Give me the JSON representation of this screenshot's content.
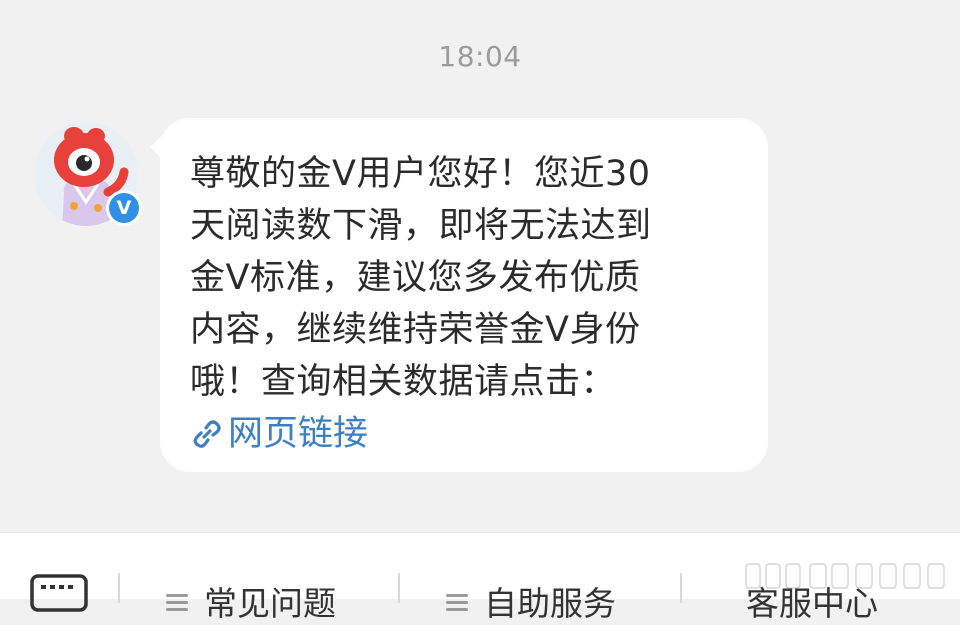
{
  "chat": {
    "timestamp": "18:04",
    "message": {
      "lines": [
        "尊敬的金V用户您好！您近30",
        "天阅读数下滑，即将无法达到",
        "金V标准，建议您多发布优质",
        "内容，继续维持荣誉金V身份",
        "哦！查询相关数据请点击："
      ],
      "link_label": "网页链接",
      "link_icon": "link-icon"
    },
    "sender": {
      "avatar_icon": "red-mascot-avatar",
      "badge_text": "V",
      "badge_color": "#2f90e8"
    }
  },
  "bottom_menu": {
    "keyboard_icon": "keyboard-icon",
    "items": [
      {
        "label": "常见问题",
        "icon": "menu-lines-icon"
      },
      {
        "label": "自助服务",
        "icon": "menu-lines-icon"
      },
      {
        "label": "客服中心",
        "icon": ""
      }
    ]
  },
  "colors": {
    "background": "#f1f1f1",
    "bubble": "#ffffff",
    "link": "#3d7fc6",
    "timestamp": "#9b9b9b"
  }
}
